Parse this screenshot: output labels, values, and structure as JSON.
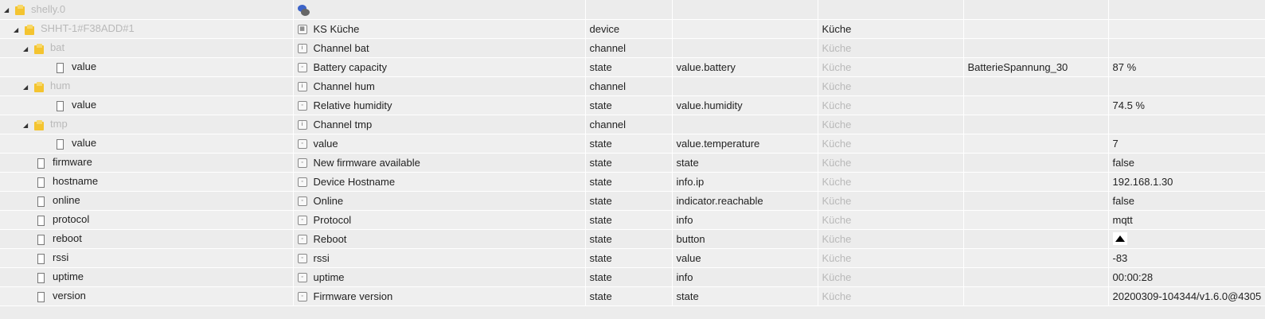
{
  "rows": [
    {
      "level": 0,
      "icon": "folder",
      "toggle": true,
      "id": "shelly.0",
      "id_muted": true,
      "name": "",
      "name_icon": "adapter",
      "type": "",
      "role": "",
      "room": "",
      "room_muted": false,
      "func": "",
      "value": ""
    },
    {
      "level": 1,
      "icon": "folder",
      "toggle": true,
      "id": "SHHT-1#F38ADD#1",
      "id_muted": true,
      "name": "KS Küche",
      "name_icon": "device",
      "type": "device",
      "role": "",
      "room": "Küche",
      "room_muted": false,
      "func": "",
      "value": ""
    },
    {
      "level": 2,
      "icon": "folder",
      "toggle": true,
      "id": "bat",
      "id_muted": true,
      "name": "Channel bat",
      "name_icon": "channel",
      "type": "channel",
      "role": "",
      "room": "Küche",
      "room_muted": true,
      "func": "",
      "value": ""
    },
    {
      "level": 3,
      "icon": "file",
      "toggle": false,
      "id": "value",
      "id_muted": false,
      "name": "Battery capacity",
      "name_icon": "state",
      "type": "state",
      "role": "value.battery",
      "room": "Küche",
      "room_muted": true,
      "func": "BatterieSpannung_30",
      "value": "87 %"
    },
    {
      "level": 2,
      "icon": "folder",
      "toggle": true,
      "id": "hum",
      "id_muted": true,
      "name": "Channel hum",
      "name_icon": "channel",
      "type": "channel",
      "role": "",
      "room": "Küche",
      "room_muted": true,
      "func": "",
      "value": ""
    },
    {
      "level": 3,
      "icon": "file",
      "toggle": false,
      "id": "value",
      "id_muted": false,
      "name": "Relative humidity",
      "name_icon": "state",
      "type": "state",
      "role": "value.humidity",
      "room": "Küche",
      "room_muted": true,
      "func": "",
      "value": "74.5 %"
    },
    {
      "level": 2,
      "icon": "folder",
      "toggle": true,
      "id": "tmp",
      "id_muted": true,
      "name": "Channel tmp",
      "name_icon": "channel",
      "type": "channel",
      "role": "",
      "room": "Küche",
      "room_muted": true,
      "func": "",
      "value": ""
    },
    {
      "level": 3,
      "icon": "file",
      "toggle": false,
      "id": "value",
      "id_muted": false,
      "name": "value",
      "name_icon": "state",
      "type": "state",
      "role": "value.temperature",
      "room": "Küche",
      "room_muted": true,
      "func": "",
      "value": "7"
    },
    {
      "level": 2,
      "icon": "file",
      "toggle": false,
      "id": "firmware",
      "id_muted": false,
      "name": "New firmware available",
      "name_icon": "state",
      "type": "state",
      "role": "state",
      "room": "Küche",
      "room_muted": true,
      "func": "",
      "value": "false"
    },
    {
      "level": 2,
      "icon": "file",
      "toggle": false,
      "id": "hostname",
      "id_muted": false,
      "name": "Device Hostname",
      "name_icon": "state",
      "type": "state",
      "role": "info.ip",
      "room": "Küche",
      "room_muted": true,
      "func": "",
      "value": "192.168.1.30"
    },
    {
      "level": 2,
      "icon": "file",
      "toggle": false,
      "id": "online",
      "id_muted": false,
      "name": "Online",
      "name_icon": "state",
      "type": "state",
      "role": "indicator.reachable",
      "room": "Küche",
      "room_muted": true,
      "func": "",
      "value": "false"
    },
    {
      "level": 2,
      "icon": "file",
      "toggle": false,
      "id": "protocol",
      "id_muted": false,
      "name": "Protocol",
      "name_icon": "state",
      "type": "state",
      "role": "info",
      "room": "Küche",
      "room_muted": true,
      "func": "",
      "value": "mqtt"
    },
    {
      "level": 2,
      "icon": "file",
      "toggle": false,
      "id": "reboot",
      "id_muted": false,
      "name": "Reboot",
      "name_icon": "state",
      "type": "state",
      "role": "button",
      "room": "Küche",
      "room_muted": true,
      "func": "",
      "value": "",
      "value_button": true
    },
    {
      "level": 2,
      "icon": "file",
      "toggle": false,
      "id": "rssi",
      "id_muted": false,
      "name": "rssi",
      "name_icon": "state",
      "type": "state",
      "role": "value",
      "room": "Küche",
      "room_muted": true,
      "func": "",
      "value": "-83"
    },
    {
      "level": 2,
      "icon": "file",
      "toggle": false,
      "id": "uptime",
      "id_muted": false,
      "name": "uptime",
      "name_icon": "state",
      "type": "state",
      "role": "info",
      "room": "Küche",
      "room_muted": true,
      "func": "",
      "value": "00:00:28"
    },
    {
      "level": 2,
      "icon": "file",
      "toggle": false,
      "id": "version",
      "id_muted": false,
      "name": "Firmware version",
      "name_icon": "state",
      "type": "state",
      "role": "state",
      "room": "Küche",
      "room_muted": true,
      "func": "",
      "value": "20200309-104344/v1.6.0@4305"
    }
  ]
}
